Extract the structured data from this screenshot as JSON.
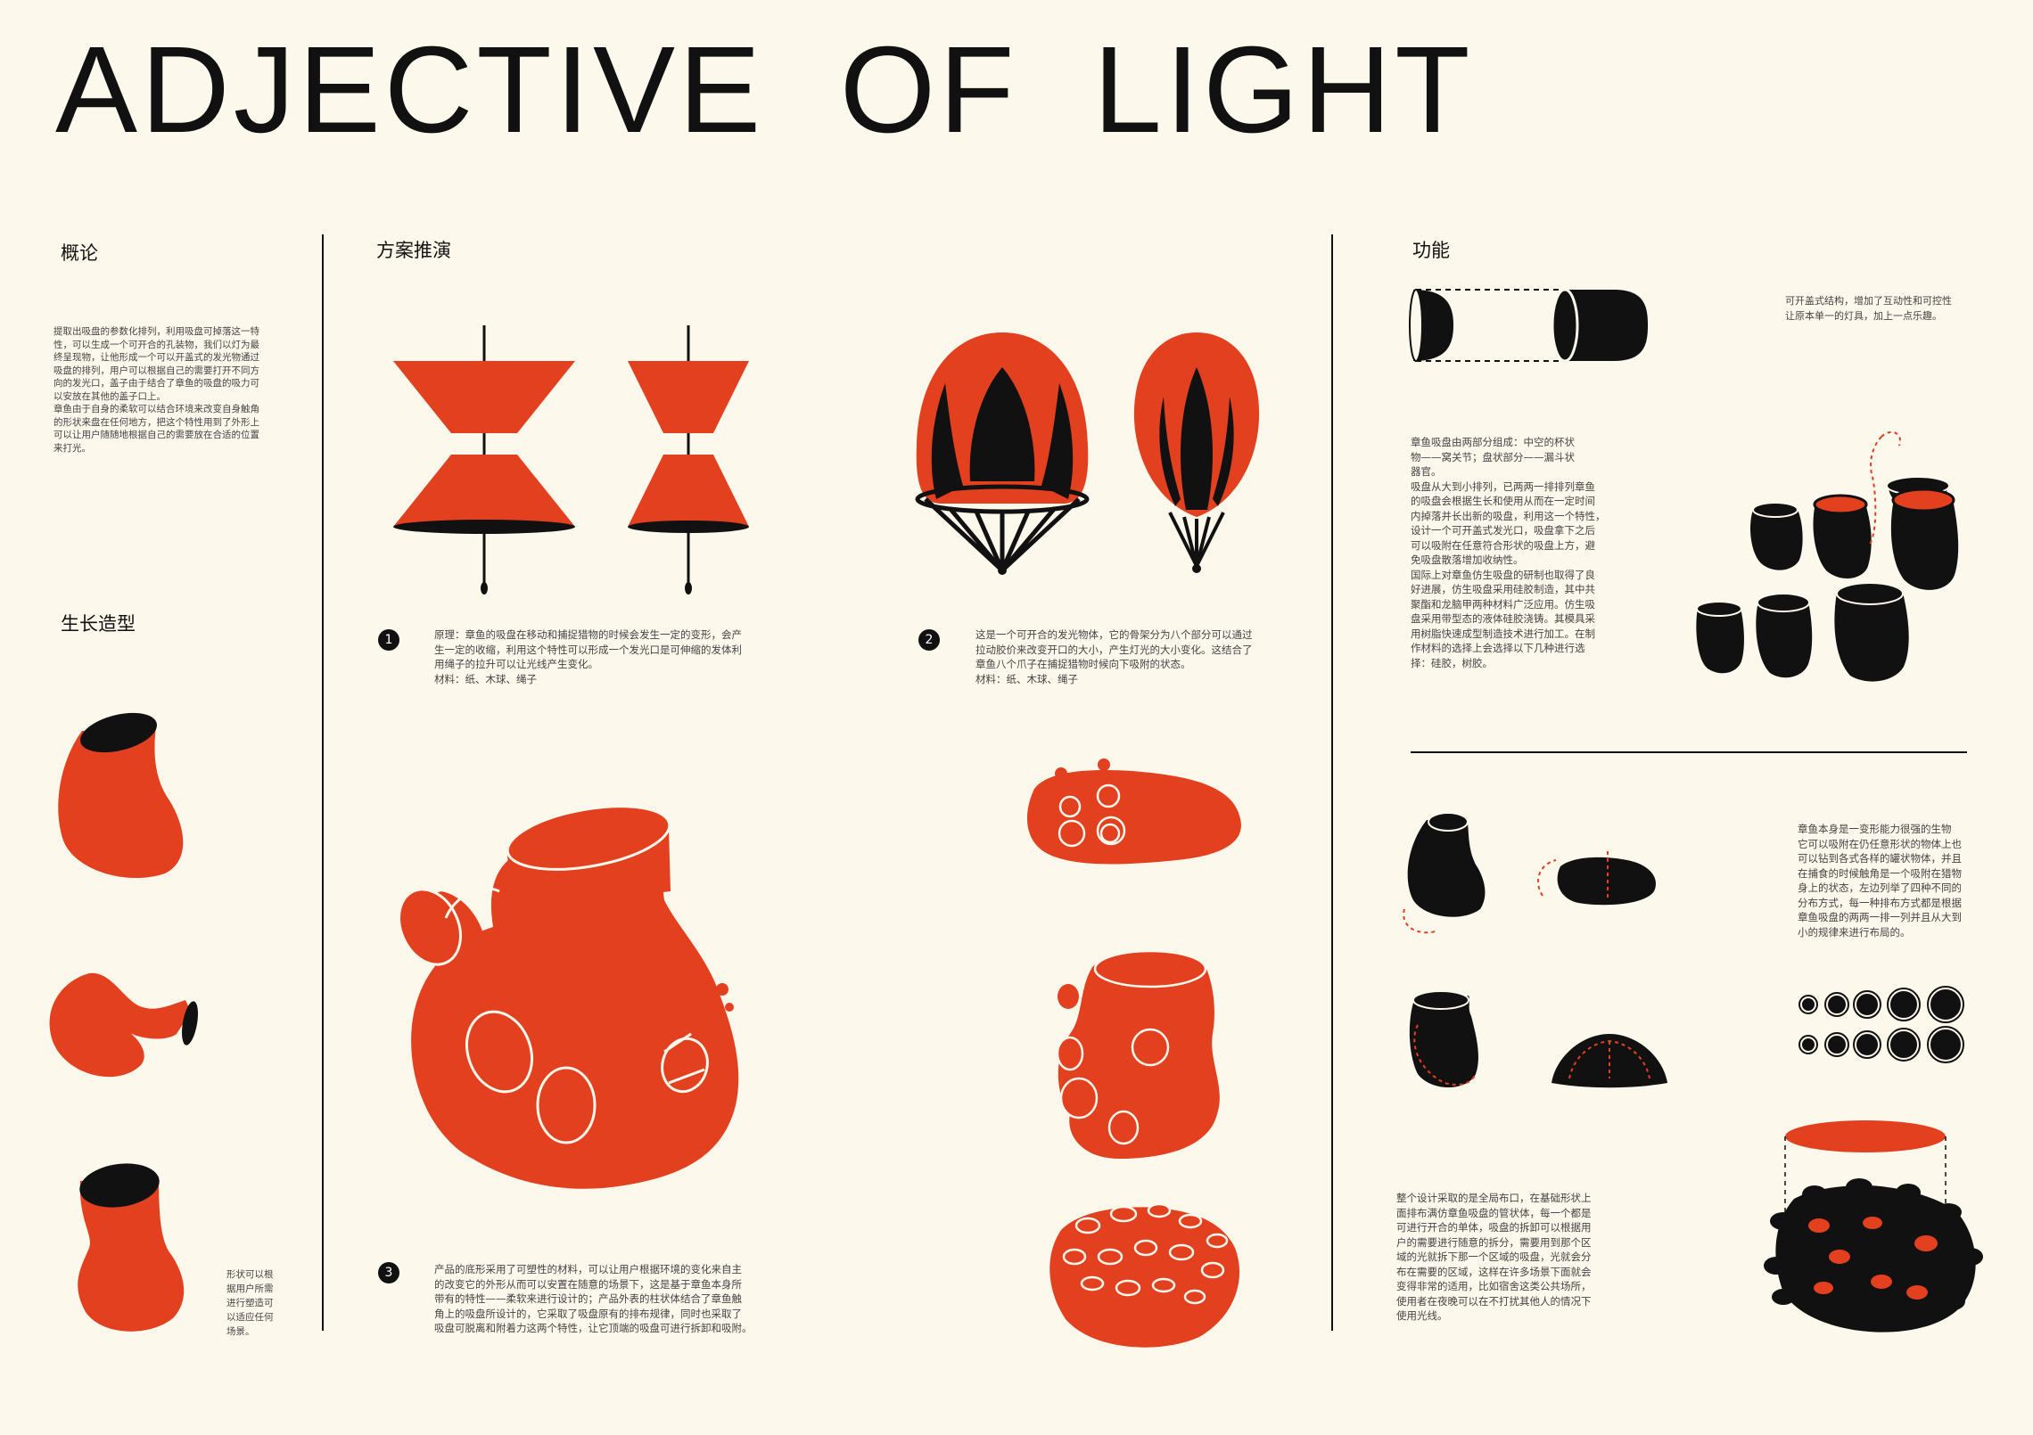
{
  "title": "ADJECTIVE  OF  LIGHT",
  "colors": {
    "background": "#fdf8ec",
    "accent": "#e3401f",
    "ink": "#111111"
  },
  "overview": {
    "heading": "概论",
    "text": "提取出吸盘的参数化排列，利用吸盘可掉落这一特\n性，可以生成一个可开合的孔装物，我们以灯为最\n终呈现物，让他形成一个可以开盖式的发光物通过\n吸盘的排列，用户可以根据自己的需要打开不同方\n向的发光口，盖子由于结合了章鱼的吸盘的吸力可\n以安放在其他的盖子口上。\n章鱼由于自身的柔软可以结合环境来改变自身触角\n的形状来盘在任何地方，把这个特性用到了外形上\n可以让用户随随地根据自己的需要放在合适的位置\n来打光。"
  },
  "growth": {
    "heading": "生长造型",
    "text": "形状可以根\n据用户所需\n进行塑造可\n以适应任何\n场景。"
  },
  "scheme": {
    "heading": "方案推演",
    "items": [
      {
        "num": "1",
        "text": "原理：章鱼的吸盘在移动和捕捉猎物的时候会发生一定的变形，会产\n生一定的收缩，利用这个特性可以形成一个发光口是可伸缩的发体利\n用绳子的拉升可以让光线产生变化。\n材料：纸、木球、绳子"
      },
      {
        "num": "2",
        "text": "这是一个可开合的发光物体，它的骨架分为八个部分可以通过\n拉动胶价来改变开口的大小，产生灯光的大小变化。这结合了\n章鱼八个爪子在捕捉猎物时候向下吸附的状态。\n材料：纸、木球、绳子"
      },
      {
        "num": "3",
        "text": "产品的底形采用了可塑性的材料，可以让用户根据环境的变化来自主\n的改变它的外形从而可以安置在随意的场景下，这是基于章鱼本身所\n带有的特性——柔软来进行设计的；产品外表的柱状体结合了章鱼触\n角上的吸盘所设计的，它采取了吸盘原有的排布规律，同时也采取了\n吸盘可脱离和附着力这两个特性，让它顶端的吸盘可进行拆卸和吸附。"
      }
    ]
  },
  "function": {
    "heading": "功能",
    "note": "可开盖式结构，增加了互动性和可控性\n让原本单一的灯具，加上一点乐趣。",
    "text1": "章鱼吸盘由两部分组成：中空的杯状\n物——窝关节；盘状部分——漏斗状\n器官。\n吸盘从大到小排列，已两两一排排列章鱼\n的吸盘会根据生长和使用从而在一定时间\n内掉落并长出新的吸盘，利用这一个特性，\n设计一个可开盖式发光口，吸盘拿下之后\n可以吸附在任意符合形状的吸盘上方，避\n免吸盘散落增加收纳性。\n国际上对章鱼仿生吸盘的研制也取得了良\n好进展，仿生吸盘采用硅胶制造，其中共\n聚酯和龙脑甲两种材料广泛应用。仿生吸\n盘采用带型态的液体硅胶浇铸。其模具采\n用树脂快速成型制造技术进行加工。在制\n作材料的选择上会选择以下几种进行选\n择：硅胶，树胶。",
    "text2": "章鱼本身是一变形能力很强的生物\n它可以吸附在仍任意形状的物体上也\n可以钻到各式各样的罐状物体，并且\n在捕食的时候触角是一个吸附在猎物\n身上的状态，左边列举了四种不同的\n分布方式，每一种排布方式都是根据\n章鱼吸盘的两两一排一列并且从大到\n小的规律来进行布局的。",
    "text3": "整个设计采取的是全局布口，在基础形状上\n面排布满仿章鱼吸盘的管状体，每一个都是\n可进行开合的单体，吸盘的拆卸可以根据用\n户的需要进行随意的拆分，需要用到那个区\n域的光就拆下那一个区域的吸盘，光就会分\n布在需要的区域，这样在许多场景下面就会\n变得非常的适用，比如宿舍这类公共场所，\n使用者在夜晚可以在不打扰其他人的情况下\n使用光线。"
  }
}
